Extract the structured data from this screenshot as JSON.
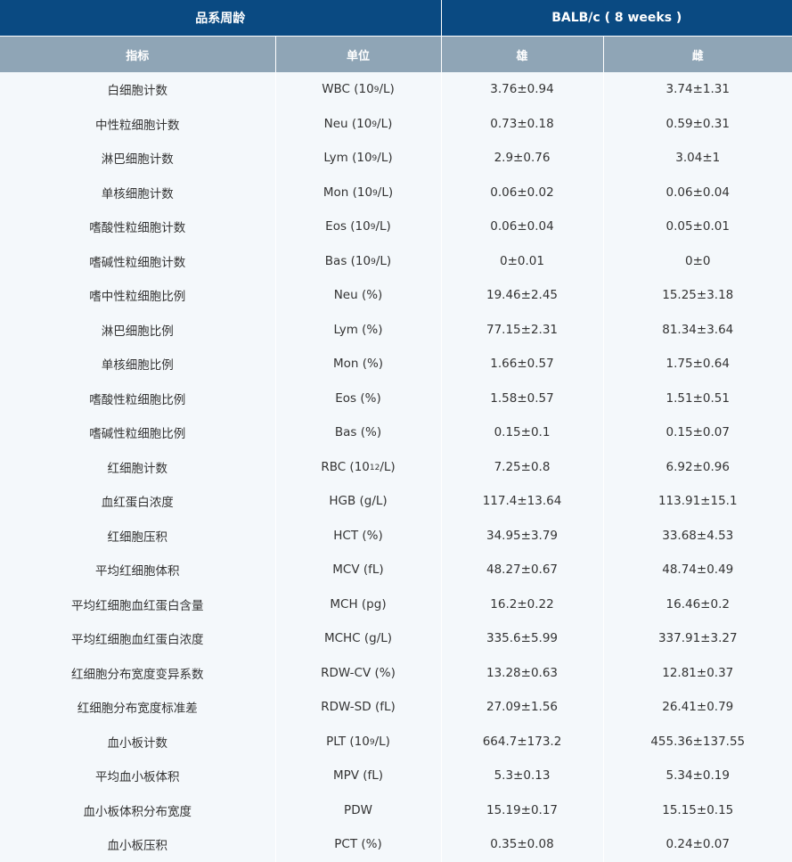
{
  "header": {
    "strain_age_label": "品系周龄",
    "strain_label": "BALB/c ( 8 weeks )"
  },
  "columns": {
    "indicator": "指标",
    "unit": "单位",
    "male": "雄",
    "female": "雌"
  },
  "rows": [
    {
      "indicator": "白细胞计数",
      "unit_prefix": "WBC (10",
      "unit_exp": "9",
      "unit_suffix": "/L)",
      "male": "3.76±0.94",
      "female": "3.74±1.31"
    },
    {
      "indicator": "中性粒细胞计数",
      "unit_prefix": "Neu (10",
      "unit_exp": "9",
      "unit_suffix": "/L)",
      "male": "0.73±0.18",
      "female": "0.59±0.31"
    },
    {
      "indicator": "淋巴细胞计数",
      "unit_prefix": "Lym (10",
      "unit_exp": "9",
      "unit_suffix": "/L)",
      "male": "2.9±0.76",
      "female": "3.04±1"
    },
    {
      "indicator": "单核细胞计数",
      "unit_prefix": "Mon (10",
      "unit_exp": "9",
      "unit_suffix": "/L)",
      "male": "0.06±0.02",
      "female": "0.06±0.04"
    },
    {
      "indicator": "嗜酸性粒细胞计数",
      "unit_prefix": "Eos (10",
      "unit_exp": "9",
      "unit_suffix": "/L)",
      "male": "0.06±0.04",
      "female": "0.05±0.01"
    },
    {
      "indicator": "嗜碱性粒细胞计数",
      "unit_prefix": "Bas (10",
      "unit_exp": "9",
      "unit_suffix": "/L)",
      "male": "0±0.01",
      "female": "0±0"
    },
    {
      "indicator": "嗜中性粒细胞比例",
      "unit_prefix": "Neu (%)",
      "unit_exp": "",
      "unit_suffix": "",
      "male": "19.46±2.45",
      "female": "15.25±3.18"
    },
    {
      "indicator": "淋巴细胞比例",
      "unit_prefix": "Lym (%)",
      "unit_exp": "",
      "unit_suffix": "",
      "male": "77.15±2.31",
      "female": "81.34±3.64"
    },
    {
      "indicator": "单核细胞比例",
      "unit_prefix": "Mon (%)",
      "unit_exp": "",
      "unit_suffix": "",
      "male": "1.66±0.57",
      "female": "1.75±0.64"
    },
    {
      "indicator": "嗜酸性粒细胞比例",
      "unit_prefix": "Eos (%)",
      "unit_exp": "",
      "unit_suffix": "",
      "male": "1.58±0.57",
      "female": "1.51±0.51"
    },
    {
      "indicator": "嗜碱性粒细胞比例",
      "unit_prefix": "Bas (%)",
      "unit_exp": "",
      "unit_suffix": "",
      "male": "0.15±0.1",
      "female": "0.15±0.07"
    },
    {
      "indicator": "红细胞计数",
      "unit_prefix": "RBC (10",
      "unit_exp": "12",
      "unit_suffix": "/L)",
      "male": "7.25±0.8",
      "female": "6.92±0.96"
    },
    {
      "indicator": "血红蛋白浓度",
      "unit_prefix": "HGB (g/L)",
      "unit_exp": "",
      "unit_suffix": "",
      "male": "117.4±13.64",
      "female": "113.91±15.1"
    },
    {
      "indicator": "红细胞压积",
      "unit_prefix": "HCT (%)",
      "unit_exp": "",
      "unit_suffix": "",
      "male": "34.95±3.79",
      "female": "33.68±4.53"
    },
    {
      "indicator": "平均红细胞体积",
      "unit_prefix": "MCV (fL)",
      "unit_exp": "",
      "unit_suffix": "",
      "male": "48.27±0.67",
      "female": "48.74±0.49"
    },
    {
      "indicator": "平均红细胞血红蛋白含量",
      "unit_prefix": "MCH (pg)",
      "unit_exp": "",
      "unit_suffix": "",
      "male": "16.2±0.22",
      "female": "16.46±0.2"
    },
    {
      "indicator": "平均红细胞血红蛋白浓度",
      "unit_prefix": "MCHC (g/L)",
      "unit_exp": "",
      "unit_suffix": "",
      "male": "335.6±5.99",
      "female": "337.91±3.27"
    },
    {
      "indicator": "红细胞分布宽度变异系数",
      "unit_prefix": "RDW-CV (%)",
      "unit_exp": "",
      "unit_suffix": "",
      "male": "13.28±0.63",
      "female": "12.81±0.37"
    },
    {
      "indicator": "红细胞分布宽度标准差",
      "unit_prefix": "RDW-SD (fL)",
      "unit_exp": "",
      "unit_suffix": "",
      "male": "27.09±1.56",
      "female": "26.41±0.79"
    },
    {
      "indicator": "血小板计数",
      "unit_prefix": "PLT (10",
      "unit_exp": "9",
      "unit_suffix": "/L)",
      "male": "664.7±173.2",
      "female": "455.36±137.55"
    },
    {
      "indicator": "平均血小板体积",
      "unit_prefix": "MPV (fL)",
      "unit_exp": "",
      "unit_suffix": "",
      "male": "5.3±0.13",
      "female": "5.34±0.19"
    },
    {
      "indicator": "血小板体积分布宽度",
      "unit_prefix": "PDW",
      "unit_exp": "",
      "unit_suffix": "",
      "male": "15.19±0.17",
      "female": "15.15±0.15"
    },
    {
      "indicator": "血小板压积",
      "unit_prefix": "PCT (%)",
      "unit_exp": "",
      "unit_suffix": "",
      "male": "0.35±0.08",
      "female": "0.24±0.07"
    }
  ]
}
